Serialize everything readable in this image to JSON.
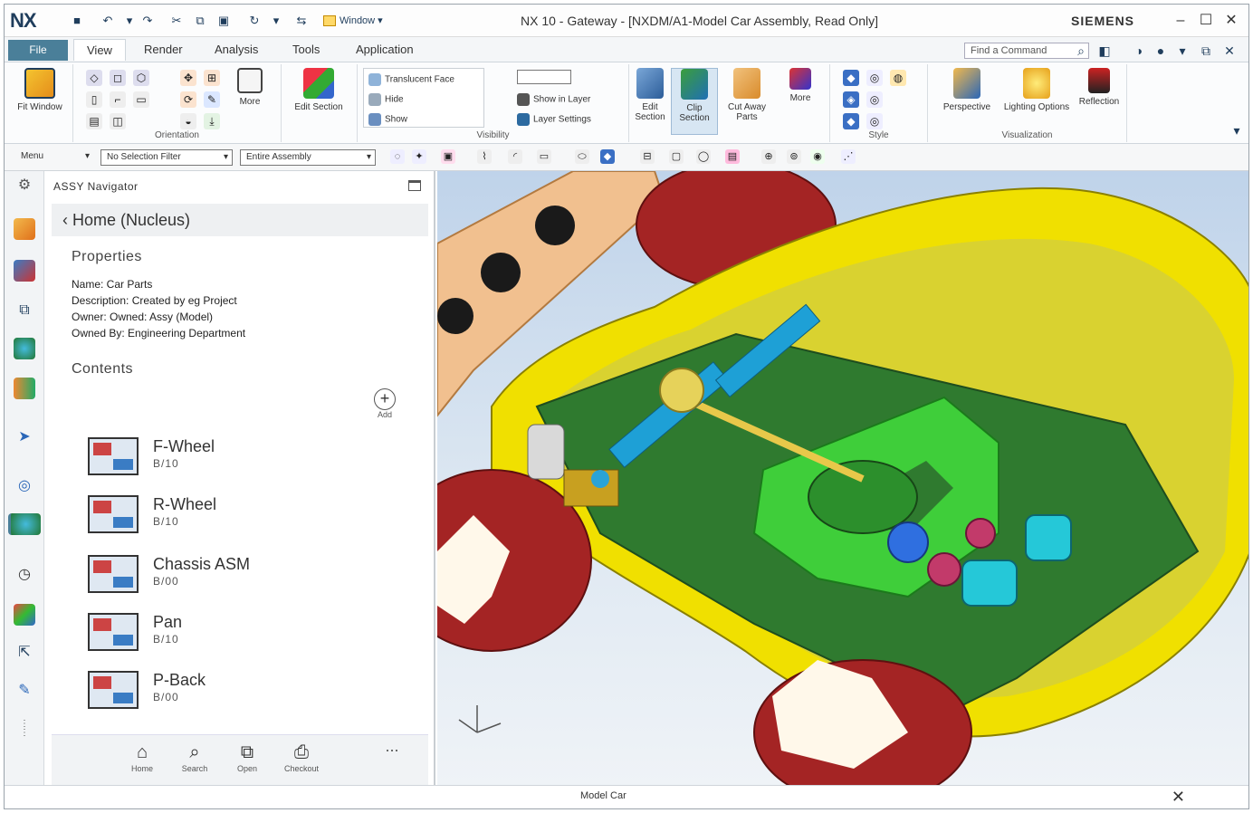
{
  "app": {
    "logo": "NX",
    "window_title": "NX 10 - Gateway - [NXDM/A1-Model Car Assembly, Read Only]",
    "brand": "SIEMENS",
    "window_controls": [
      "minimize",
      "maximize",
      "close"
    ]
  },
  "quick_access": [
    "save-icon",
    "undo-icon",
    "redo-icon",
    "cut-icon",
    "copy-icon",
    "paste-icon",
    "repeat-icon",
    "switch-window-icon"
  ],
  "quick_access_window_label": "Window",
  "menu": {
    "file_label": "File",
    "tabs": [
      "View",
      "Render",
      "Analysis",
      "Tools",
      "Application"
    ],
    "active_tab": "View",
    "find_placeholder": "Find a Command"
  },
  "ribbon": {
    "groups": [
      {
        "label": "",
        "buttons": [
          "Fit Window"
        ]
      },
      {
        "label": "Orientation",
        "buttons": [
          "More"
        ]
      },
      {
        "label": "",
        "buttons": [
          "Edit Section"
        ]
      },
      {
        "label": "Visibility",
        "items": [
          "Translucent Face",
          "Hide",
          "Show",
          "Show in Layer",
          "Layer Settings"
        ]
      },
      {
        "label": "",
        "buttons": [
          "Edit Section",
          "Clip Section",
          "Cut Away Parts",
          "More"
        ]
      },
      {
        "label": "Style",
        "buttons": []
      },
      {
        "label": "Visualization",
        "buttons": [
          "Perspective",
          "Lighting Options",
          "Reflection"
        ]
      }
    ]
  },
  "selection_bar": {
    "menu_label": "Menu",
    "filter": "No Selection Filter",
    "scope": "Entire Assembly"
  },
  "navigator": {
    "header": "ASSY Navigator",
    "breadcrumb": "Home (Nucleus)",
    "properties_title": "Properties",
    "properties": [
      "Name: Car Parts",
      "Description: Created by eg Project",
      "Owner: Owned: Assy (Model)",
      "Owned By: Engineering Department"
    ],
    "contents_title": "Contents",
    "add_label": "Add",
    "items": [
      {
        "name": "F-Wheel",
        "sub": "B/10"
      },
      {
        "name": "R-Wheel",
        "sub": "B/10"
      },
      {
        "name": "Chassis ASM",
        "sub": "B/00"
      },
      {
        "name": "Pan",
        "sub": "B/10"
      },
      {
        "name": "P-Back",
        "sub": "B/00"
      }
    ],
    "footer": [
      "Home",
      "Search",
      "Open",
      "Checkout"
    ],
    "more": "..."
  },
  "status": {
    "text": "Model Car",
    "close_glyph": "✕"
  },
  "colors": {
    "accent": "#4a7f99",
    "body": "#f0e000",
    "chassis": "#2f7a2f",
    "bracket": "#3fce3a",
    "wheel": "#a42424",
    "gear": "#1ea0d6"
  }
}
